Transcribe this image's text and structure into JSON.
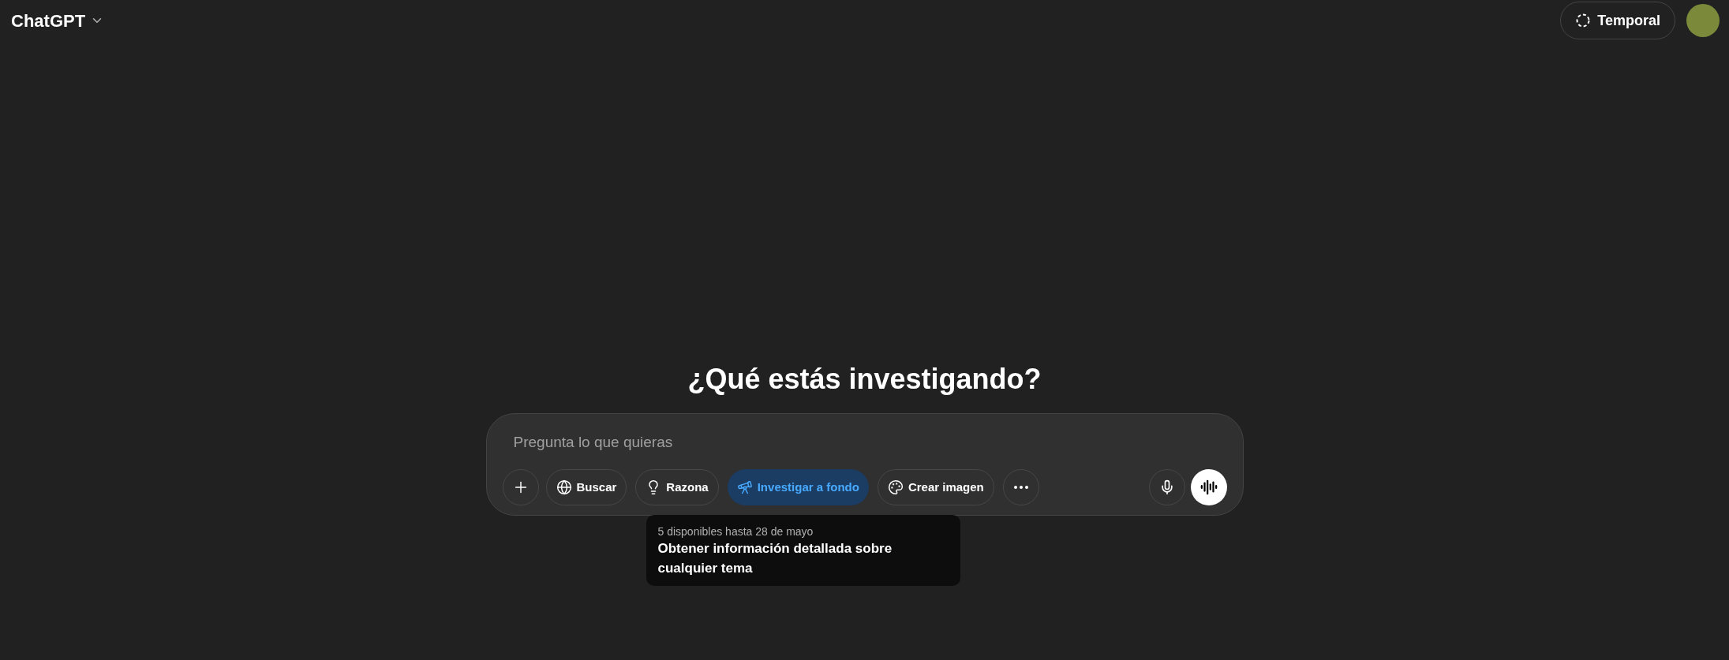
{
  "header": {
    "title": "ChatGPT",
    "temporal_button": "Temporal"
  },
  "heading": "¿Qué estás investigando?",
  "composer": {
    "placeholder": "Pregunta lo que quieras",
    "tools": [
      {
        "label": "Buscar",
        "selected": false
      },
      {
        "label": "Razona",
        "selected": false
      },
      {
        "label": "Investigar a fondo",
        "selected": true
      },
      {
        "label": "Crear imagen",
        "selected": false
      }
    ]
  },
  "tooltip": {
    "note": "5 disponibles hasta 28 de mayo",
    "text": "Obtener información detallada sobre cualquier tema"
  }
}
